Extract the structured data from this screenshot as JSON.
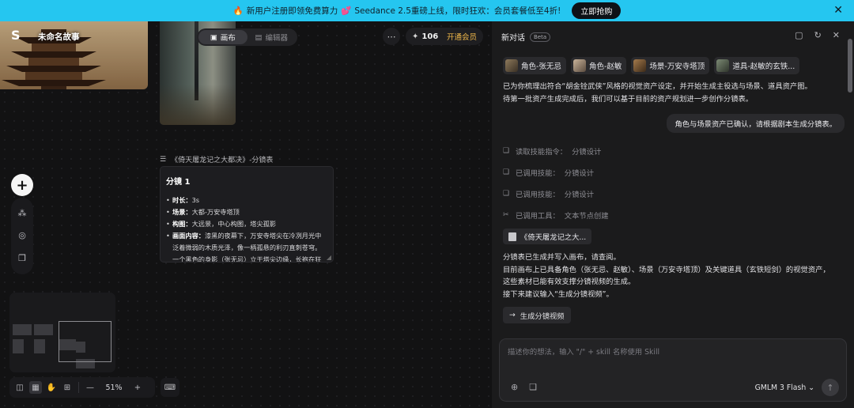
{
  "banner": {
    "emoji": "🔥",
    "text_a": "新用户注册即领免费算力",
    "emoji_b": "💕",
    "text_b": "Seedance 2.5重磅上线，限时狂欢：会员套餐低至4折!",
    "cta_label": "立即抢购",
    "close_icon": "✕",
    "color": "#25c6f0"
  },
  "canvas": {
    "story_title": "未命名故事",
    "view_tabs": [
      {
        "label": "画布",
        "active": true
      },
      {
        "label": "编辑器",
        "active": false
      }
    ],
    "credits": "106",
    "vip_label": "开通会员",
    "storyboard_label": "《倚天屠龙记之大都决》-分镜表",
    "shot": {
      "title": "分镜 1",
      "lines": [
        {
          "key": "时长：",
          "value": "3s"
        },
        {
          "key": "场景：",
          "value": "大都-万安寺塔顶"
        },
        {
          "key": "构图：",
          "value": "大远景，中心构图，塔尖孤影"
        },
        {
          "key": "画面内容：",
          "value": "漆黑的夜幕下，万安寺塔尖在冷冽月光中泛着微弱的木质光泽，像一柄孤悬的利刃直刺苍穹。一个黑色的身影（张无忌）立于塔尖边缘，长袍在狂"
        }
      ]
    },
    "zoom": "51%",
    "zoom_out": "—",
    "zoom_in": "+",
    "add_label": "+"
  },
  "chat": {
    "title": "新对话",
    "beta": "Beta",
    "assets": [
      {
        "label": "角色-张无忌"
      },
      {
        "label": "角色-赵敏"
      },
      {
        "label": "场景-万安寺塔顶"
      },
      {
        "label": "道具-赵敏的玄铁..."
      }
    ],
    "ai_msg_1_line_1": "已为你梳理出符合“胡金铨武侠”风格的视觉资产设定，并开始生成主役选与场景、道具资产图。",
    "ai_msg_1_line_2": "待第一批资产生成完成后，我们可以基于目前的资产规划进一步创作分镜表。",
    "user_msg": "角色与场景资产已确认，请根据剧本生成分镜表。",
    "steps": [
      {
        "label": "读取技能指令：",
        "value": "分镜设计"
      },
      {
        "label": "已调用技能：",
        "value": "分镜设计"
      },
      {
        "label": "已调用技能：",
        "value": "分镜设计"
      },
      {
        "label": "已调用工具：",
        "value": "文本节点创建"
      }
    ],
    "doc_chip": "《倚天屠龙记之大...",
    "ai_msg_2_lines": [
      "分镜表已生成并写入画布，请查阅。",
      "目前画布上已具备角色（张无忌、赵敏）、场景（万安寺塔顶）及关键道具（玄铁短剑）的视觉资产，",
      "这些素材已能有效支撑分镜视频的生成。",
      "接下来建议输入“生成分镜视频”。"
    ],
    "suggestion": "生成分镜视频",
    "composer_placeholder": "描述你的想法，输入 \"/\" + skill 名称使用 Skill",
    "model": "GMLM 3 Flash",
    "model_chevron": "⌄"
  }
}
